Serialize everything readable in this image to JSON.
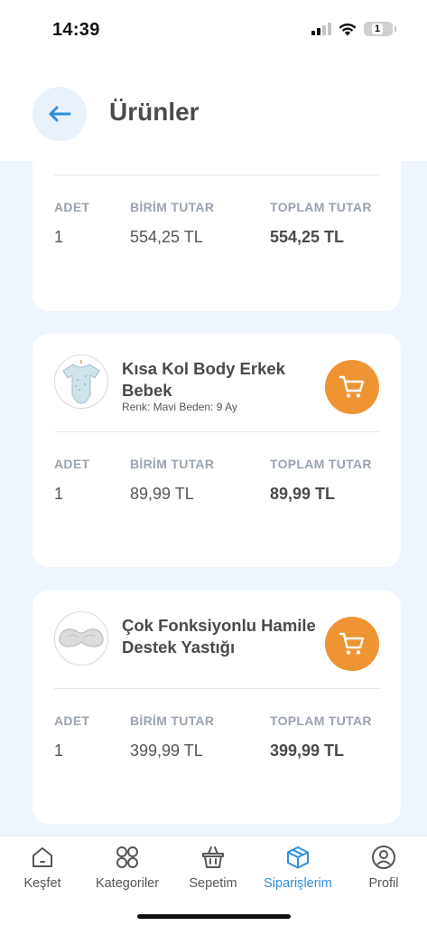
{
  "status_bar": {
    "time": "14:39",
    "battery": "1"
  },
  "header": {
    "title": "Ürünler",
    "back_icon": "arrow-left-icon"
  },
  "columns": {
    "quantity": "ADET",
    "unit_price": "BİRİM TUTAR",
    "total_price": "TOPLAM TUTAR"
  },
  "orders": [
    {
      "quantity": "1",
      "unit_price": "554,25 TL",
      "total_price": "554,25 TL"
    },
    {
      "name": "Kısa Kol Body Erkek Bebek",
      "variant": "Renk: Mavi  Beden: 9 Ay",
      "quantity": "1",
      "unit_price": "89,99 TL",
      "total_price": "89,99 TL"
    },
    {
      "name": "Çok Fonksiyonlu Hamile Destek Yastığı",
      "quantity": "1",
      "unit_price": "399,99 TL",
      "total_price": "399,99 TL"
    }
  ],
  "tabbar": {
    "items": [
      {
        "label": "Keşfet",
        "icon": "home-icon"
      },
      {
        "label": "Kategoriler",
        "icon": "grid-icon"
      },
      {
        "label": "Sepetim",
        "icon": "basket-icon"
      },
      {
        "label": "Siparişlerim",
        "icon": "box-icon",
        "active": true
      },
      {
        "label": "Profil",
        "icon": "user-icon"
      }
    ]
  },
  "colors": {
    "accent": "#2f8fdc",
    "cart_button": "#ef9433",
    "background": "#eef5fd"
  }
}
